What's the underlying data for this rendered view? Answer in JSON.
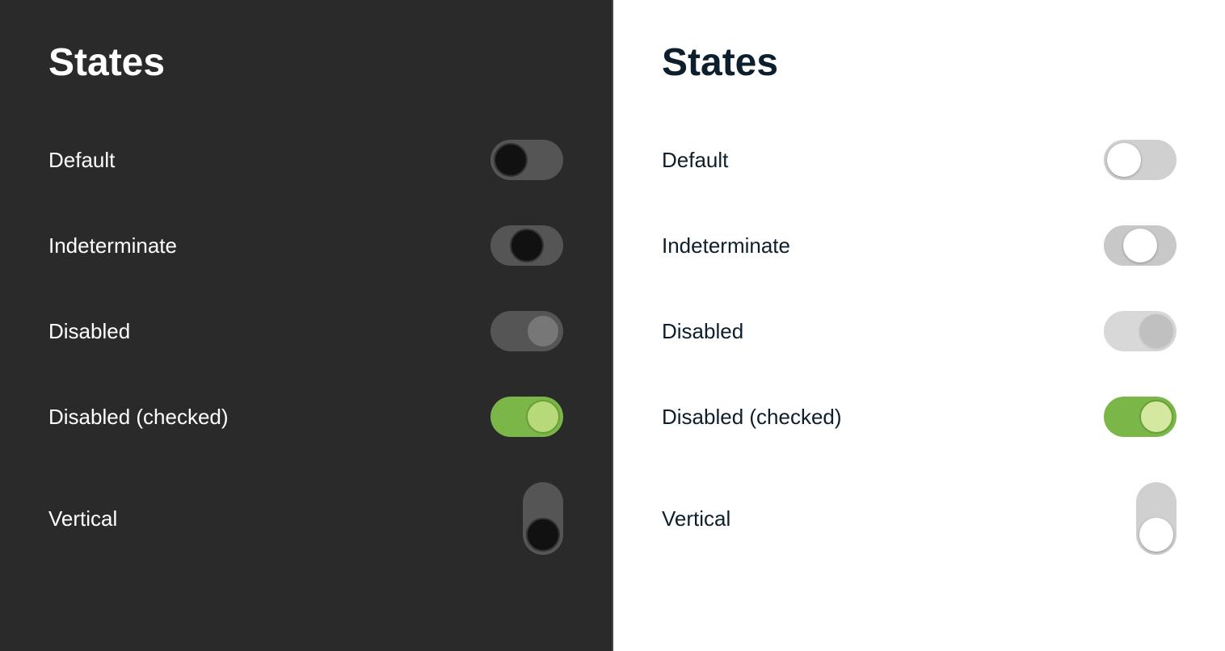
{
  "dark_panel": {
    "title": "States",
    "rows": [
      {
        "id": "default",
        "label": "Default"
      },
      {
        "id": "indeterminate",
        "label": "Indeterminate"
      },
      {
        "id": "disabled",
        "label": "Disabled"
      },
      {
        "id": "disabled-checked",
        "label": "Disabled (checked)"
      },
      {
        "id": "vertical",
        "label": "Vertical"
      }
    ]
  },
  "light_panel": {
    "title": "States",
    "rows": [
      {
        "id": "default",
        "label": "Default"
      },
      {
        "id": "indeterminate",
        "label": "Indeterminate"
      },
      {
        "id": "disabled",
        "label": "Disabled"
      },
      {
        "id": "disabled-checked",
        "label": "Disabled (checked)"
      },
      {
        "id": "vertical",
        "label": "Vertical"
      }
    ]
  }
}
